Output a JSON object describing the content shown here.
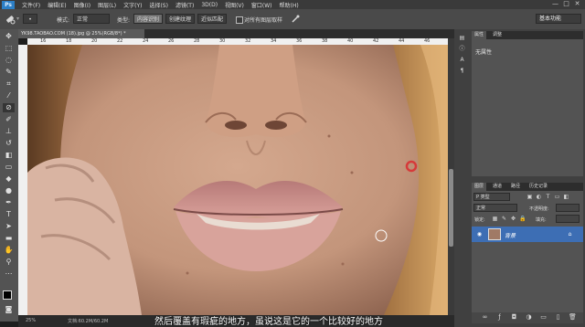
{
  "menu": {
    "logo": "Ps",
    "items": [
      "文件(F)",
      "编辑(E)",
      "图像(I)",
      "图层(L)",
      "文字(Y)",
      "选择(S)",
      "滤镜(T)",
      "3D(D)",
      "视图(V)",
      "窗口(W)",
      "帮助(H)"
    ]
  },
  "window": {
    "minimize": "—",
    "maximize": "□",
    "close": "✕"
  },
  "options": {
    "mode_label": "模式:",
    "mode_value": "正常",
    "type_label": "类型:",
    "type_content_aware": "内容识别",
    "type_create_texture": "创建纹理",
    "type_proximity": "近似匹配",
    "sample_all_layers": "对所有图层取样",
    "workspace": "基本功能",
    "active_type": "内容识别"
  },
  "document": {
    "tab_title": "YK98.TAOBAO.COM (18).jpg @ 25%(RGB/8*) *",
    "ruler_marks": [
      "16",
      "18",
      "20",
      "22",
      "24",
      "26",
      "28",
      "30",
      "32",
      "34",
      "36",
      "38",
      "40",
      "42",
      "44",
      "46",
      "48"
    ]
  },
  "status": {
    "zoom": "25%",
    "doc_size": "文档:60.2M/60.2M"
  },
  "subtitle": "然后覆盖有瑕疵的地方，虽说这是它的一个比较好的地方",
  "properties": {
    "tabs": [
      "属性",
      "调整"
    ],
    "title": "无属性"
  },
  "layers": {
    "tabs": [
      "图层",
      "通道",
      "路径",
      "历史记录"
    ],
    "filter_label": "P 类型",
    "blend_mode": "正常",
    "opacity_label": "不透明度:",
    "lock_label": "锁定:",
    "fill_label": "填充:",
    "layer_name": "背景"
  },
  "colors": {
    "accent_blue": "#3d6eb4",
    "brush_ring": "#d63a3a"
  }
}
